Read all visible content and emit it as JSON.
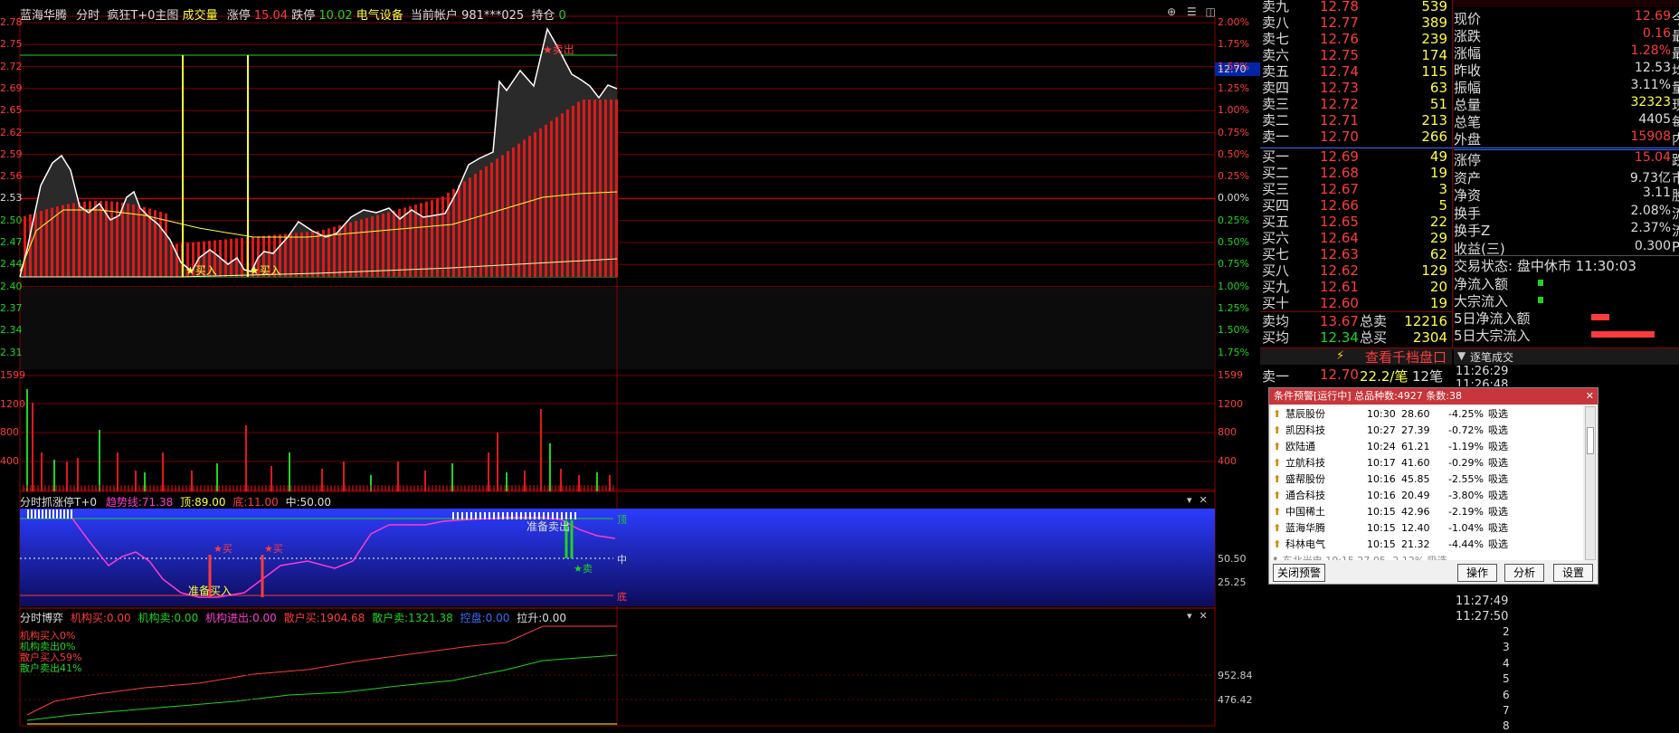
{
  "header": {
    "stock": "蓝海华腾",
    "mode": "分时",
    "strategy": "疯狂T+0主图",
    "vol_label": "成交量",
    "limit_up_label": "涨停",
    "limit_up": "15.04",
    "limit_down_label": "跌停",
    "limit_down": "10.02",
    "sector": "电气设备",
    "account_label": "当前帐户",
    "account": "981***025",
    "position_label": "持仓",
    "position": "0"
  },
  "price_axis": {
    "left": [
      "2.78",
      "2.75",
      "2.72",
      "2.69",
      "2.65",
      "2.62",
      "2.59",
      "2.56",
      "2.53",
      "2.50",
      "2.47",
      "2.44",
      "2.40",
      "2.37",
      "2.34",
      "2.31"
    ],
    "right": [
      "2.00%",
      "1.75%",
      "1.50%",
      "1.25%",
      "1.00%",
      "0.75%",
      "0.50%",
      "0.25%",
      "0.00%",
      "0.25%",
      "0.50%",
      "0.75%",
      "1.00%",
      "1.25%",
      "1.50%",
      "1.75%"
    ],
    "current_tag": "12.70"
  },
  "vol_axis": {
    "left": [
      "1599",
      "1200",
      "800",
      "400"
    ],
    "right": [
      "1599",
      "1200",
      "800",
      "400"
    ]
  },
  "signals": {
    "buy1": "★买入",
    "buy2": "★买入",
    "sell": "★卖出"
  },
  "panel2": {
    "title": "分时抓涨停T+0",
    "trend_label": "趋势线:",
    "trend": "71.38",
    "top_label": "顶:",
    "top": "89.00",
    "bottom_label": "底:",
    "bottom": "11.00",
    "mid_label": "中:",
    "mid": "50.00",
    "lbl_top": "顶",
    "lbl_mid": "中",
    "lbl_bottom": "底",
    "prep_buy": "准备买入",
    "prep_sell": "准备卖出",
    "buy": "★买",
    "sell": "★卖",
    "axis1": "50.50",
    "axis2": "25.25"
  },
  "panel3": {
    "title": "分时博弈",
    "l1": "机构买:",
    "v1": "0.00",
    "l2": "机构卖:",
    "v2": "0.00",
    "l3": "机构进出:",
    "v3": "0.00",
    "l4": "散户买:",
    "v4": "1904.68",
    "l5": "散户卖:",
    "v5": "1321.38",
    "l6": "控盘:",
    "v6": "0.00",
    "l7": "拉升:",
    "v7": "0.00",
    "legend": [
      "机构买入0%",
      "机构卖出0%",
      "散户买入59%",
      "散户卖出41%"
    ],
    "axis1": "952.84",
    "axis2": "476.42"
  },
  "orderbook": {
    "sells": [
      {
        "l": "卖九",
        "p": "12.78",
        "v": "539"
      },
      {
        "l": "卖八",
        "p": "12.77",
        "v": "389"
      },
      {
        "l": "卖七",
        "p": "12.76",
        "v": "239"
      },
      {
        "l": "卖六",
        "p": "12.75",
        "v": "174"
      },
      {
        "l": "卖五",
        "p": "12.74",
        "v": "115"
      },
      {
        "l": "卖四",
        "p": "12.73",
        "v": "63"
      },
      {
        "l": "卖三",
        "p": "12.72",
        "v": "51"
      },
      {
        "l": "卖二",
        "p": "12.71",
        "v": "213"
      },
      {
        "l": "卖一",
        "p": "12.70",
        "v": "266"
      }
    ],
    "buys": [
      {
        "l": "买一",
        "p": "12.69",
        "v": "49"
      },
      {
        "l": "买二",
        "p": "12.68",
        "v": "19"
      },
      {
        "l": "买三",
        "p": "12.67",
        "v": "3"
      },
      {
        "l": "买四",
        "p": "12.66",
        "v": "5"
      },
      {
        "l": "买五",
        "p": "12.65",
        "v": "22"
      },
      {
        "l": "买六",
        "p": "12.64",
        "v": "29"
      },
      {
        "l": "买七",
        "p": "12.63",
        "v": "62"
      },
      {
        "l": "买八",
        "p": "12.62",
        "v": "129"
      },
      {
        "l": "买九",
        "p": "12.61",
        "v": "20"
      },
      {
        "l": "买十",
        "p": "12.60",
        "v": "19"
      }
    ],
    "avg_sell_label": "卖均",
    "avg_sell": "13.67",
    "total_sell_label": "总卖",
    "total_sell": "12216",
    "avg_buy_label": "买均",
    "avg_buy": "12.34",
    "total_buy_label": "总买",
    "total_buy": "2304"
  },
  "stats": [
    {
      "l": "现价",
      "v": "12.69",
      "s": "今"
    },
    {
      "l": "涨跌",
      "v": "0.16",
      "s": "最"
    },
    {
      "l": "涨幅",
      "v": "1.28%",
      "s": "最"
    },
    {
      "l": "昨收",
      "v": "12.53",
      "s": "均"
    },
    {
      "l": "振幅",
      "v": "3.11%",
      "s": "量"
    },
    {
      "l": "总量",
      "v": "32323",
      "s": "现"
    },
    {
      "l": "总笔",
      "v": "4405",
      "s": "每"
    },
    {
      "l": "外盘",
      "v": "15908",
      "s": "内"
    }
  ],
  "stats2": [
    {
      "l": "涨停",
      "v": "15.04",
      "s": "跌"
    },
    {
      "l": "资产",
      "v": "9.73亿",
      "s": "市"
    },
    {
      "l": "净资",
      "v": "3.11",
      "s": "股"
    },
    {
      "l": "换手",
      "v": "2.08%",
      "s": "流"
    },
    {
      "l": "换手Z",
      "v": "2.37%",
      "s": "流"
    },
    {
      "l": "收益(三)",
      "v": "0.300",
      "s": "P"
    }
  ],
  "trade_state": "交易状态: 盘中休市 11:30:03",
  "flows": [
    "净流入额",
    "大宗流入",
    "5日净流入额",
    "5日大宗流入"
  ],
  "view_depth": "查看千档盘口",
  "tick_title": "逐笔成交",
  "sell1_row": {
    "l": "卖一",
    "p": "12.70",
    "avg": "22.2/笔",
    "cnt": "12笔"
  },
  "ticks": [
    "11:26:29",
    "11:26:48",
    "11:27:49",
    "11:27:50"
  ],
  "tick_nums": [
    "2",
    "3",
    "4",
    "5",
    "6",
    "7",
    "8"
  ],
  "popup": {
    "title": "条件预警[运行中] 总品种数:4927 条数:38",
    "items": [
      {
        "n": "慧辰股份",
        "t": "10:30",
        "p": "28.60",
        "c": "-4.25%",
        "s": "吸选"
      },
      {
        "n": "凯因科技",
        "t": "10:27",
        "p": "27.39",
        "c": "-0.72%",
        "s": "吸选"
      },
      {
        "n": "欧陆通",
        "t": "10:24",
        "p": "61.21",
        "c": "-1.19%",
        "s": "吸选"
      },
      {
        "n": "立航科技",
        "t": "10:17",
        "p": "41.60",
        "c": "-0.29%",
        "s": "吸选"
      },
      {
        "n": "盛帮股份",
        "t": "10:16",
        "p": "45.85",
        "c": "-2.55%",
        "s": "吸选"
      },
      {
        "n": "通合科技",
        "t": "10:16",
        "p": "20.49",
        "c": "-3.80%",
        "s": "吸选"
      },
      {
        "n": "中国稀土",
        "t": "10:15",
        "p": "42.96",
        "c": "-2.19%",
        "s": "吸选"
      },
      {
        "n": "蓝海华腾",
        "t": "10:15",
        "p": "12.40",
        "c": "-1.04%",
        "s": "吸选"
      },
      {
        "n": "科林电气",
        "t": "10:15",
        "p": "21.32",
        "c": "-4.44%",
        "s": "吸选"
      }
    ],
    "close": "关闭预警",
    "op": "操作",
    "an": "分析",
    "set": "设置"
  }
}
